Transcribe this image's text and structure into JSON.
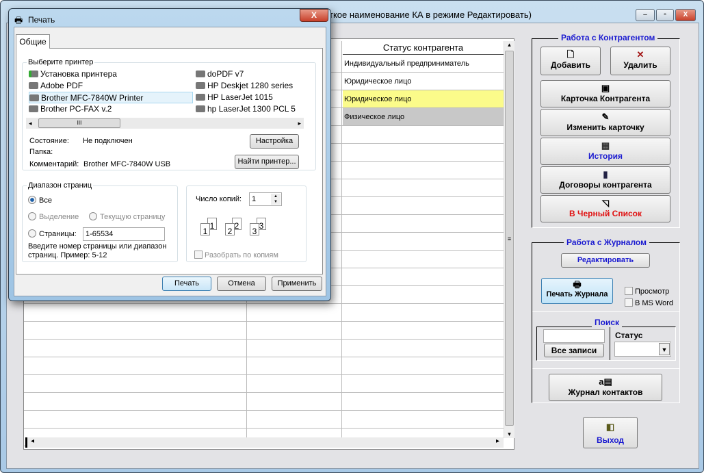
{
  "main_window": {
    "title_visible": "ткое наименование КА в режиме Редактировать)",
    "min": "–",
    "max": "▫",
    "close": "X"
  },
  "grid": {
    "columns": [
      "",
      "",
      "Статус контрагента"
    ],
    "rows": [
      {
        "status": "Индивидуальный предприниматель",
        "highlight": "none"
      },
      {
        "status": "Юридическое лицо",
        "highlight": "none"
      },
      {
        "status": "Юридическое лицо",
        "highlight": "#fbfb8a"
      },
      {
        "status": "Физическое лицо",
        "highlight": "#c8c8c8"
      }
    ],
    "scroll_left": "◂",
    "scroll_right": "▸",
    "scroll_up": "▴",
    "scroll_down": "▾",
    "grip": "≡"
  },
  "contragent_panel": {
    "title": "Работа с Контрагентом",
    "add": "Добавить",
    "delete": "Удалить",
    "card": "Карточка Контрагента",
    "edit_card": "Изменить карточку",
    "history": "История",
    "contracts": "Договоры контрагента",
    "blacklist": "В Черный Список"
  },
  "journal_panel": {
    "title": "Работа с Журналом",
    "edit": "Редактировать",
    "print": "Печать Журнала",
    "preview": "Просмотр",
    "msword": "В MS Word",
    "search_title": "Поиск",
    "search_value": "",
    "all_records": "Все записи",
    "status_label": "Статус",
    "status_value": "",
    "contacts": "Журнал контактов"
  },
  "exit": "Выход",
  "colors": {
    "accent_blue": "#1a1ad0",
    "red": "#e01010"
  },
  "print_dialog": {
    "title": "Печать",
    "close": "X",
    "tab": "Общие",
    "select_printer": "Выберите принтер",
    "printers_left": [
      "Установка принтера",
      "Adobe PDF",
      "Brother MFC-7840W Printer",
      "Brother PC-FAX v.2"
    ],
    "printers_right": [
      "doPDF v7",
      "HP Deskjet 1280 series",
      "HP LaserJet 1015",
      "hp LaserJet 1300 PCL 5"
    ],
    "selected_printer": "Brother MFC-7840W Printer",
    "scroll_thumb": "III",
    "state_label": "Состояние:",
    "state_value": "Не подключен",
    "folder_label": "Папка:",
    "comment_label": "Комментарий:",
    "comment_value": "Brother MFC-7840W USB",
    "setup": "Настройка",
    "find_printer": "Найти принтер...",
    "range_title": "Диапазон страниц",
    "all": "Все",
    "selection": "Выделение",
    "current_page": "Текущую страницу",
    "pages": "Страницы:",
    "pages_value": "1-65534",
    "hint": "Введите номер страницы или диапазон",
    "hint2": "страниц.  Пример: 5-12",
    "copies_label": "Число копий:",
    "copies_value": "1",
    "collate": "Разобрать по копиям",
    "collate_pages": [
      "1",
      "1",
      "2",
      "2",
      "3",
      "3"
    ],
    "print": "Печать",
    "cancel": "Отмена",
    "apply": "Применить"
  }
}
